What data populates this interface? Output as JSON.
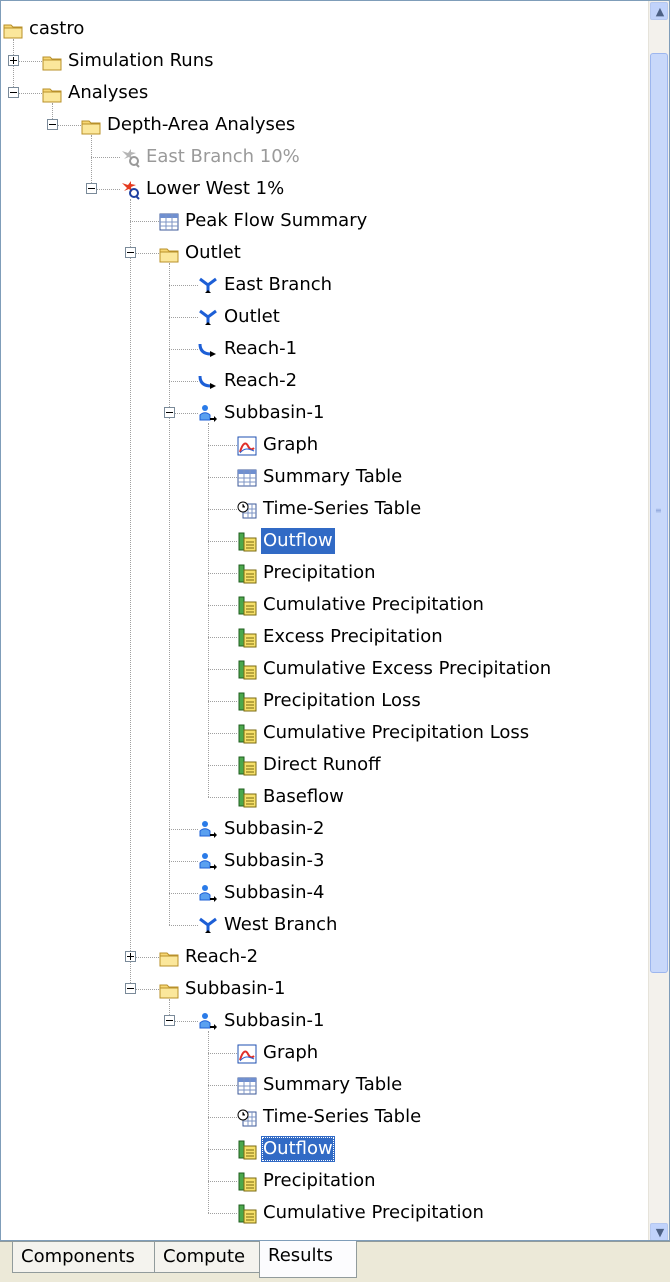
{
  "tree": [
    {
      "label": "castro",
      "icon": "folder-icon",
      "depth": 0,
      "expander": null
    },
    {
      "label": "Simulation Runs",
      "icon": "folder-icon",
      "depth": 1,
      "expander": "plus"
    },
    {
      "label": "Analyses",
      "icon": "folder-icon",
      "depth": 1,
      "expander": "minus"
    },
    {
      "label": "Depth-Area Analyses",
      "icon": "folder-icon",
      "depth": 2,
      "expander": "minus"
    },
    {
      "label": "East Branch 10%",
      "icon": "analysis-disabled-icon",
      "depth": 3,
      "expander": null,
      "dim": true
    },
    {
      "label": "Lower West 1%",
      "icon": "analysis-icon",
      "depth": 3,
      "expander": "minus"
    },
    {
      "label": "Peak Flow Summary",
      "icon": "table-icon",
      "depth": 4,
      "expander": null
    },
    {
      "label": "Outlet",
      "icon": "folder-icon",
      "depth": 4,
      "expander": "minus"
    },
    {
      "label": "East Branch",
      "icon": "junction-icon",
      "depth": 5,
      "expander": null
    },
    {
      "label": "Outlet",
      "icon": "junction-icon",
      "depth": 5,
      "expander": null
    },
    {
      "label": "Reach-1",
      "icon": "reach-icon",
      "depth": 5,
      "expander": null
    },
    {
      "label": "Reach-2",
      "icon": "reach-icon",
      "depth": 5,
      "expander": null
    },
    {
      "label": "Subbasin-1",
      "icon": "subbasin-icon",
      "depth": 5,
      "expander": "minus"
    },
    {
      "label": "Graph",
      "icon": "graph-icon",
      "depth": 6,
      "expander": null
    },
    {
      "label": "Summary Table",
      "icon": "table-icon",
      "depth": 6,
      "expander": null
    },
    {
      "label": "Time-Series Table",
      "icon": "time-series-table-icon",
      "depth": 6,
      "expander": null
    },
    {
      "label": "Outflow",
      "icon": "time-series-icon",
      "depth": 6,
      "expander": null,
      "selected": true
    },
    {
      "label": "Precipitation",
      "icon": "time-series-icon",
      "depth": 6,
      "expander": null
    },
    {
      "label": "Cumulative Precipitation",
      "icon": "time-series-icon",
      "depth": 6,
      "expander": null
    },
    {
      "label": "Excess Precipitation",
      "icon": "time-series-icon",
      "depth": 6,
      "expander": null
    },
    {
      "label": "Cumulative Excess Precipitation",
      "icon": "time-series-icon",
      "depth": 6,
      "expander": null
    },
    {
      "label": "Precipitation Loss",
      "icon": "time-series-icon",
      "depth": 6,
      "expander": null
    },
    {
      "label": "Cumulative Precipitation Loss",
      "icon": "time-series-icon",
      "depth": 6,
      "expander": null
    },
    {
      "label": "Direct Runoff",
      "icon": "time-series-icon",
      "depth": 6,
      "expander": null
    },
    {
      "label": "Baseflow",
      "icon": "time-series-icon",
      "depth": 6,
      "expander": null
    },
    {
      "label": "Subbasin-2",
      "icon": "subbasin-icon",
      "depth": 5,
      "expander": null
    },
    {
      "label": "Subbasin-3",
      "icon": "subbasin-icon",
      "depth": 5,
      "expander": null
    },
    {
      "label": "Subbasin-4",
      "icon": "subbasin-icon",
      "depth": 5,
      "expander": null
    },
    {
      "label": "West Branch",
      "icon": "junction-icon",
      "depth": 5,
      "expander": null
    },
    {
      "label": "Reach-2",
      "icon": "folder-icon",
      "depth": 4,
      "expander": "plus"
    },
    {
      "label": "Subbasin-1",
      "icon": "folder-icon",
      "depth": 4,
      "expander": "minus"
    },
    {
      "label": "Subbasin-1",
      "icon": "subbasin-icon",
      "depth": 5,
      "expander": "minus"
    },
    {
      "label": "Graph",
      "icon": "graph-icon",
      "depth": 6,
      "expander": null
    },
    {
      "label": "Summary Table",
      "icon": "table-icon",
      "depth": 6,
      "expander": null
    },
    {
      "label": "Time-Series Table",
      "icon": "time-series-table-icon",
      "depth": 6,
      "expander": null
    },
    {
      "label": "Outflow",
      "icon": "time-series-icon",
      "depth": 6,
      "expander": null,
      "selected": true,
      "focused": true
    },
    {
      "label": "Precipitation",
      "icon": "time-series-icon",
      "depth": 6,
      "expander": null
    },
    {
      "label": "Cumulative Precipitation",
      "icon": "time-series-icon",
      "depth": 6,
      "expander": null
    }
  ],
  "tabs": [
    {
      "label": "Components",
      "active": false
    },
    {
      "label": "Compute",
      "active": false
    },
    {
      "label": "Results",
      "active": true
    }
  ],
  "colors": {
    "selection": "#316ac5",
    "folder": "#f7d774",
    "scroll_thumb": "#c8d8fa"
  }
}
